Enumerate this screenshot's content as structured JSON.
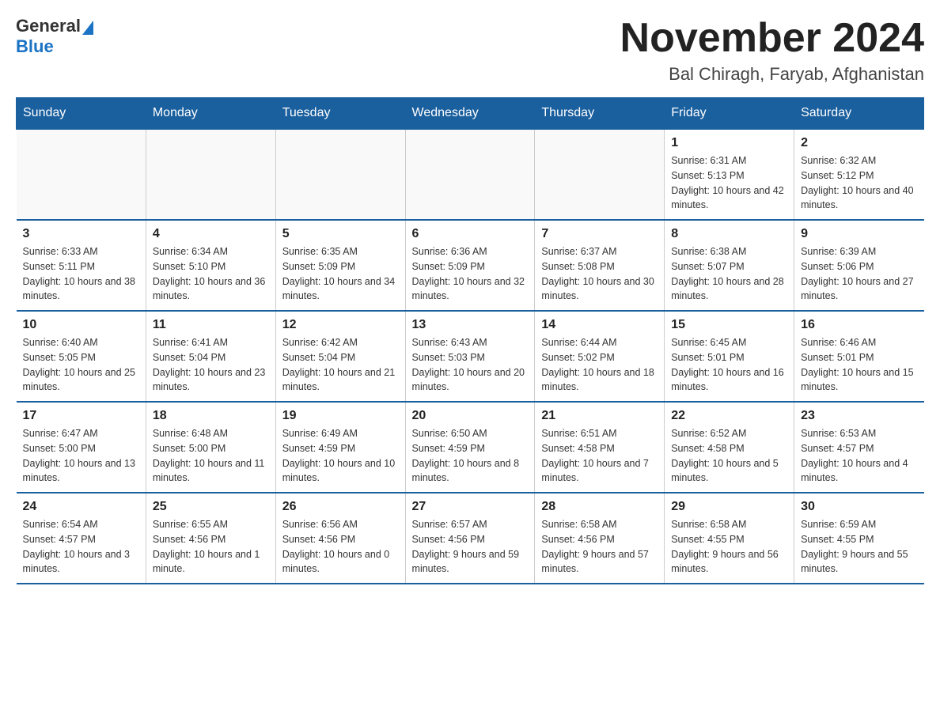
{
  "logo": {
    "general": "General",
    "blue": "Blue"
  },
  "title": {
    "month": "November 2024",
    "location": "Bal Chiragh, Faryab, Afghanistan"
  },
  "weekdays": [
    "Sunday",
    "Monday",
    "Tuesday",
    "Wednesday",
    "Thursday",
    "Friday",
    "Saturday"
  ],
  "weeks": [
    [
      {
        "day": "",
        "info": ""
      },
      {
        "day": "",
        "info": ""
      },
      {
        "day": "",
        "info": ""
      },
      {
        "day": "",
        "info": ""
      },
      {
        "day": "",
        "info": ""
      },
      {
        "day": "1",
        "info": "Sunrise: 6:31 AM\nSunset: 5:13 PM\nDaylight: 10 hours and 42 minutes."
      },
      {
        "day": "2",
        "info": "Sunrise: 6:32 AM\nSunset: 5:12 PM\nDaylight: 10 hours and 40 minutes."
      }
    ],
    [
      {
        "day": "3",
        "info": "Sunrise: 6:33 AM\nSunset: 5:11 PM\nDaylight: 10 hours and 38 minutes."
      },
      {
        "day": "4",
        "info": "Sunrise: 6:34 AM\nSunset: 5:10 PM\nDaylight: 10 hours and 36 minutes."
      },
      {
        "day": "5",
        "info": "Sunrise: 6:35 AM\nSunset: 5:09 PM\nDaylight: 10 hours and 34 minutes."
      },
      {
        "day": "6",
        "info": "Sunrise: 6:36 AM\nSunset: 5:09 PM\nDaylight: 10 hours and 32 minutes."
      },
      {
        "day": "7",
        "info": "Sunrise: 6:37 AM\nSunset: 5:08 PM\nDaylight: 10 hours and 30 minutes."
      },
      {
        "day": "8",
        "info": "Sunrise: 6:38 AM\nSunset: 5:07 PM\nDaylight: 10 hours and 28 minutes."
      },
      {
        "day": "9",
        "info": "Sunrise: 6:39 AM\nSunset: 5:06 PM\nDaylight: 10 hours and 27 minutes."
      }
    ],
    [
      {
        "day": "10",
        "info": "Sunrise: 6:40 AM\nSunset: 5:05 PM\nDaylight: 10 hours and 25 minutes."
      },
      {
        "day": "11",
        "info": "Sunrise: 6:41 AM\nSunset: 5:04 PM\nDaylight: 10 hours and 23 minutes."
      },
      {
        "day": "12",
        "info": "Sunrise: 6:42 AM\nSunset: 5:04 PM\nDaylight: 10 hours and 21 minutes."
      },
      {
        "day": "13",
        "info": "Sunrise: 6:43 AM\nSunset: 5:03 PM\nDaylight: 10 hours and 20 minutes."
      },
      {
        "day": "14",
        "info": "Sunrise: 6:44 AM\nSunset: 5:02 PM\nDaylight: 10 hours and 18 minutes."
      },
      {
        "day": "15",
        "info": "Sunrise: 6:45 AM\nSunset: 5:01 PM\nDaylight: 10 hours and 16 minutes."
      },
      {
        "day": "16",
        "info": "Sunrise: 6:46 AM\nSunset: 5:01 PM\nDaylight: 10 hours and 15 minutes."
      }
    ],
    [
      {
        "day": "17",
        "info": "Sunrise: 6:47 AM\nSunset: 5:00 PM\nDaylight: 10 hours and 13 minutes."
      },
      {
        "day": "18",
        "info": "Sunrise: 6:48 AM\nSunset: 5:00 PM\nDaylight: 10 hours and 11 minutes."
      },
      {
        "day": "19",
        "info": "Sunrise: 6:49 AM\nSunset: 4:59 PM\nDaylight: 10 hours and 10 minutes."
      },
      {
        "day": "20",
        "info": "Sunrise: 6:50 AM\nSunset: 4:59 PM\nDaylight: 10 hours and 8 minutes."
      },
      {
        "day": "21",
        "info": "Sunrise: 6:51 AM\nSunset: 4:58 PM\nDaylight: 10 hours and 7 minutes."
      },
      {
        "day": "22",
        "info": "Sunrise: 6:52 AM\nSunset: 4:58 PM\nDaylight: 10 hours and 5 minutes."
      },
      {
        "day": "23",
        "info": "Sunrise: 6:53 AM\nSunset: 4:57 PM\nDaylight: 10 hours and 4 minutes."
      }
    ],
    [
      {
        "day": "24",
        "info": "Sunrise: 6:54 AM\nSunset: 4:57 PM\nDaylight: 10 hours and 3 minutes."
      },
      {
        "day": "25",
        "info": "Sunrise: 6:55 AM\nSunset: 4:56 PM\nDaylight: 10 hours and 1 minute."
      },
      {
        "day": "26",
        "info": "Sunrise: 6:56 AM\nSunset: 4:56 PM\nDaylight: 10 hours and 0 minutes."
      },
      {
        "day": "27",
        "info": "Sunrise: 6:57 AM\nSunset: 4:56 PM\nDaylight: 9 hours and 59 minutes."
      },
      {
        "day": "28",
        "info": "Sunrise: 6:58 AM\nSunset: 4:56 PM\nDaylight: 9 hours and 57 minutes."
      },
      {
        "day": "29",
        "info": "Sunrise: 6:58 AM\nSunset: 4:55 PM\nDaylight: 9 hours and 56 minutes."
      },
      {
        "day": "30",
        "info": "Sunrise: 6:59 AM\nSunset: 4:55 PM\nDaylight: 9 hours and 55 minutes."
      }
    ]
  ]
}
